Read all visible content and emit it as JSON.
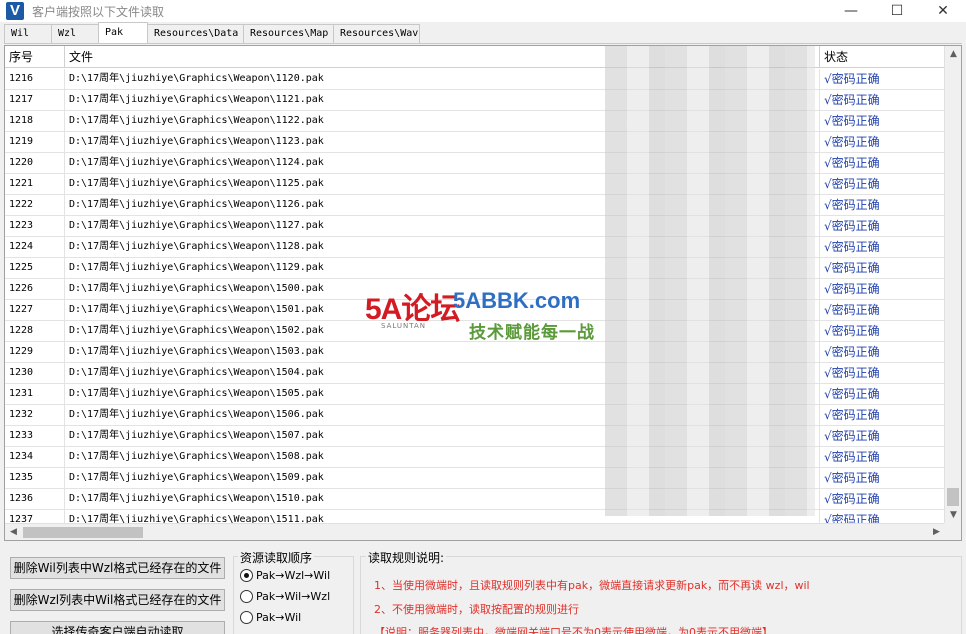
{
  "window": {
    "title": "客户端按照以下文件读取",
    "icon": "V",
    "controls": {
      "minimize": "—",
      "maximize": "☐",
      "close": "✕"
    }
  },
  "tabs": [
    {
      "label": "Wil"
    },
    {
      "label": "Wzl"
    },
    {
      "label": "Pak"
    },
    {
      "label": "Resources\\Data"
    },
    {
      "label": "Resources\\Map"
    },
    {
      "label": "Resources\\Wav"
    }
  ],
  "table": {
    "columns": [
      "序号",
      "文件",
      "状态"
    ],
    "rows": [
      {
        "id": "1216",
        "file": "D:\\17周年\\jiuzhiye\\Graphics\\Weapon\\1120.pak",
        "status": "√密码正确"
      },
      {
        "id": "1217",
        "file": "D:\\17周年\\jiuzhiye\\Graphics\\Weapon\\1121.pak",
        "status": "√密码正确"
      },
      {
        "id": "1218",
        "file": "D:\\17周年\\jiuzhiye\\Graphics\\Weapon\\1122.pak",
        "status": "√密码正确"
      },
      {
        "id": "1219",
        "file": "D:\\17周年\\jiuzhiye\\Graphics\\Weapon\\1123.pak",
        "status": "√密码正确"
      },
      {
        "id": "1220",
        "file": "D:\\17周年\\jiuzhiye\\Graphics\\Weapon\\1124.pak",
        "status": "√密码正确"
      },
      {
        "id": "1221",
        "file": "D:\\17周年\\jiuzhiye\\Graphics\\Weapon\\1125.pak",
        "status": "√密码正确"
      },
      {
        "id": "1222",
        "file": "D:\\17周年\\jiuzhiye\\Graphics\\Weapon\\1126.pak",
        "status": "√密码正确"
      },
      {
        "id": "1223",
        "file": "D:\\17周年\\jiuzhiye\\Graphics\\Weapon\\1127.pak",
        "status": "√密码正确"
      },
      {
        "id": "1224",
        "file": "D:\\17周年\\jiuzhiye\\Graphics\\Weapon\\1128.pak",
        "status": "√密码正确"
      },
      {
        "id": "1225",
        "file": "D:\\17周年\\jiuzhiye\\Graphics\\Weapon\\1129.pak",
        "status": "√密码正确"
      },
      {
        "id": "1226",
        "file": "D:\\17周年\\jiuzhiye\\Graphics\\Weapon\\1500.pak",
        "status": "√密码正确"
      },
      {
        "id": "1227",
        "file": "D:\\17周年\\jiuzhiye\\Graphics\\Weapon\\1501.pak",
        "status": "√密码正确"
      },
      {
        "id": "1228",
        "file": "D:\\17周年\\jiuzhiye\\Graphics\\Weapon\\1502.pak",
        "status": "√密码正确"
      },
      {
        "id": "1229",
        "file": "D:\\17周年\\jiuzhiye\\Graphics\\Weapon\\1503.pak",
        "status": "√密码正确"
      },
      {
        "id": "1230",
        "file": "D:\\17周年\\jiuzhiye\\Graphics\\Weapon\\1504.pak",
        "status": "√密码正确"
      },
      {
        "id": "1231",
        "file": "D:\\17周年\\jiuzhiye\\Graphics\\Weapon\\1505.pak",
        "status": "√密码正确"
      },
      {
        "id": "1232",
        "file": "D:\\17周年\\jiuzhiye\\Graphics\\Weapon\\1506.pak",
        "status": "√密码正确"
      },
      {
        "id": "1233",
        "file": "D:\\17周年\\jiuzhiye\\Graphics\\Weapon\\1507.pak",
        "status": "√密码正确"
      },
      {
        "id": "1234",
        "file": "D:\\17周年\\jiuzhiye\\Graphics\\Weapon\\1508.pak",
        "status": "√密码正确"
      },
      {
        "id": "1235",
        "file": "D:\\17周年\\jiuzhiye\\Graphics\\Weapon\\1509.pak",
        "status": "√密码正确"
      },
      {
        "id": "1236",
        "file": "D:\\17周年\\jiuzhiye\\Graphics\\Weapon\\1510.pak",
        "status": "√密码正确"
      },
      {
        "id": "1237",
        "file": "D:\\17周年\\jiuzhiye\\Graphics\\Weapon\\1511.pak",
        "status": "√密码正确"
      }
    ]
  },
  "watermark": {
    "logo": "5A论坛",
    "logo_sub": "SALUNTAN",
    "site": "5ABBK.com",
    "slogan": "技术赋能每一战"
  },
  "buttons": {
    "delete_wil": "删除Wil列表中Wzl格式已经存在的文件",
    "delete_wzl": "删除Wzl列表中Wil格式已经存在的文件",
    "auto_read": "选择传奇客户端自动读取"
  },
  "resource_order": {
    "title": "资源读取顺序",
    "options": [
      {
        "label": "Pak→Wzl→Wil",
        "checked": true
      },
      {
        "label": "Pak→Wil→Wzl",
        "checked": false
      },
      {
        "label": "Pak→Wil",
        "checked": false
      }
    ]
  },
  "rules": {
    "title": "读取规则说明:",
    "lines": [
      "1、当使用微端时，且读取规则列表中有pak，微端直接请求更新pak，而不再读 wzl，wil",
      "2、不使用微端时，读取按配置的规则进行",
      "【说明：服务器列表中，微端网关端口号不为0表示使用微端，为0表示不用微端】"
    ]
  },
  "colors": {
    "status_text": "#1e3fae",
    "rule_red": "#e0302a",
    "app_icon": "#1c5aa6"
  }
}
